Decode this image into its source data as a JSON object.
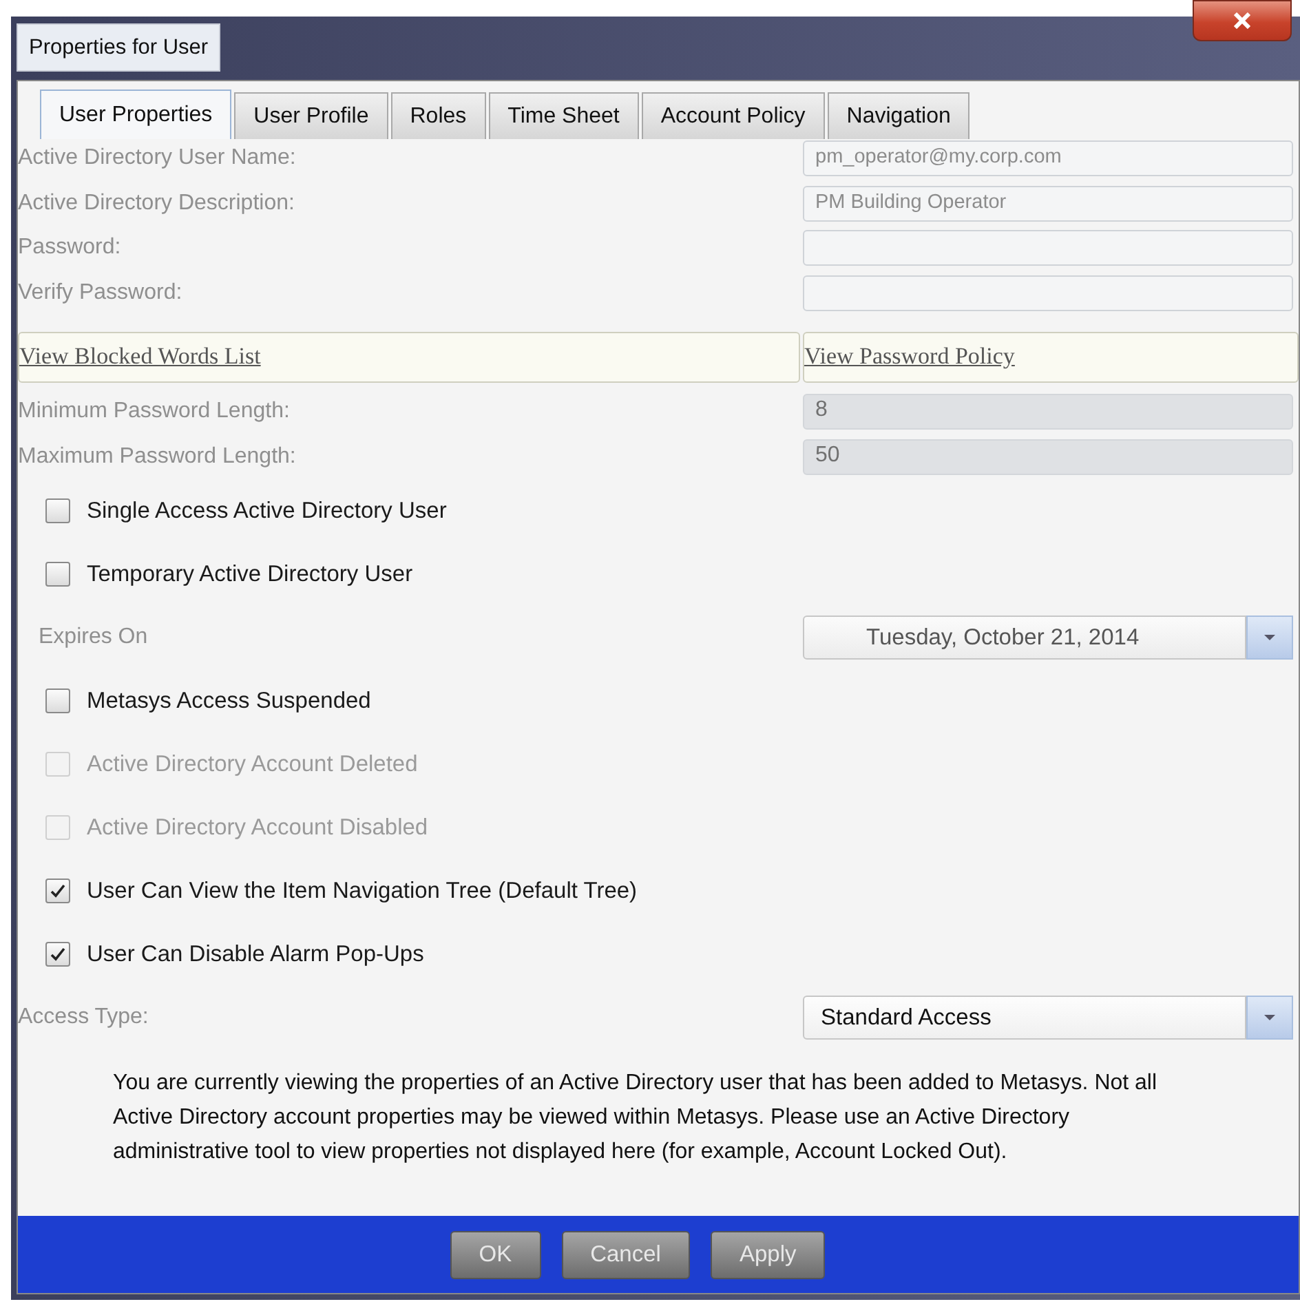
{
  "window": {
    "title": "Properties for User"
  },
  "tabs": [
    {
      "label": "User Properties",
      "selected": true
    },
    {
      "label": "User Profile",
      "selected": false
    },
    {
      "label": "Roles",
      "selected": false
    },
    {
      "label": "Time Sheet",
      "selected": false
    },
    {
      "label": "Account Policy",
      "selected": false
    },
    {
      "label": "Navigation",
      "selected": false
    }
  ],
  "fields": [
    {
      "label": "Active Directory User Name:",
      "value": "pm_operator@my.corp.com"
    },
    {
      "label": "Active Directory Description:",
      "value": "PM Building Operator"
    },
    {
      "label": "Password:"
    },
    {
      "label": "Verify Password:"
    }
  ],
  "links": [
    "View Blocked Words List",
    "View Password Policy"
  ],
  "length_fields": [
    {
      "label": "Minimum Password Length:",
      "value": "8"
    },
    {
      "label": "Maximum Password Length:",
      "value": "50"
    }
  ],
  "options": [
    {
      "kind": "checkbox",
      "label": "Single Access Active Directory User",
      "checked": false,
      "disabled": false
    },
    {
      "kind": "checkbox",
      "label": "Temporary Active Directory User",
      "checked": false,
      "disabled": false
    },
    {
      "kind": "date",
      "label": "Expires On",
      "value": "Tuesday, October 21, 2014"
    },
    {
      "kind": "checkbox",
      "label": "Metasys Access Suspended",
      "checked": false,
      "disabled": false
    },
    {
      "kind": "checkbox",
      "label": "Active Directory Account Deleted",
      "checked": false,
      "disabled": true
    },
    {
      "kind": "checkbox",
      "label": "Active Directory Account Disabled",
      "checked": false,
      "disabled": true
    },
    {
      "kind": "checkbox",
      "label": "User Can View the Item Navigation Tree (Default Tree)",
      "checked": true,
      "disabled": false
    },
    {
      "kind": "checkbox",
      "label": "User Can Disable Alarm Pop-Ups",
      "checked": true,
      "disabled": false
    }
  ],
  "access_type": {
    "label": "Access Type:",
    "value": "Standard Access"
  },
  "note": "You are currently viewing the properties of an Active Directory user that has been added to Metasys.  Not all Active Directory account properties may be viewed within Metasys.  Please use an Active Directory administrative tool to view properties not displayed here (for example, Account Locked Out).",
  "buttons": [
    "OK",
    "Cancel",
    "Apply"
  ]
}
